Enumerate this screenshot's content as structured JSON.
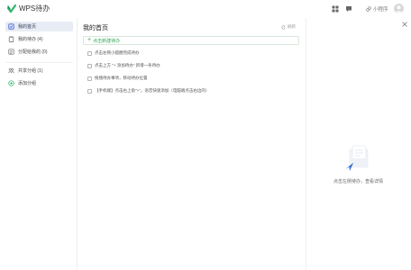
{
  "app": {
    "title": "WPS待办",
    "brand_color": "#2db56a",
    "accent_color": "#34a853"
  },
  "titlebar": {
    "grid_icon": "grid-icon",
    "chat_icon": "chat-icon",
    "mini_program_label": "小程序",
    "avatar": "user-avatar"
  },
  "sidebar": {
    "items": [
      {
        "label": "我的首页",
        "icon": "home-icon",
        "active": true
      },
      {
        "label": "我的待办 (4)",
        "icon": "clipboard-icon",
        "active": false
      },
      {
        "label": "分配给我的 (0)",
        "icon": "assign-icon",
        "active": false
      },
      {
        "label": "共享分组 (1)",
        "icon": "share-group-icon",
        "active": false
      },
      {
        "label": "添加分组",
        "icon": "plus-circle-icon",
        "active": false
      }
    ]
  },
  "main": {
    "title": "我的首页",
    "refresh_label": "刷新",
    "add_placeholder": "点击新建待办",
    "tasks": [
      "点击左侧小圆圈完成待办",
      "点击上方 \"+ 添加待办\" 新增一条待办",
      "拖拽待办事项，移动待办位置",
      "【手机端】点击右上角\"+\"，语音快速添加（电脑端点击右边的）"
    ]
  },
  "detail": {
    "empty_text": "点击左侧待办，查看详情",
    "illustration": "empty-document-illustration"
  }
}
